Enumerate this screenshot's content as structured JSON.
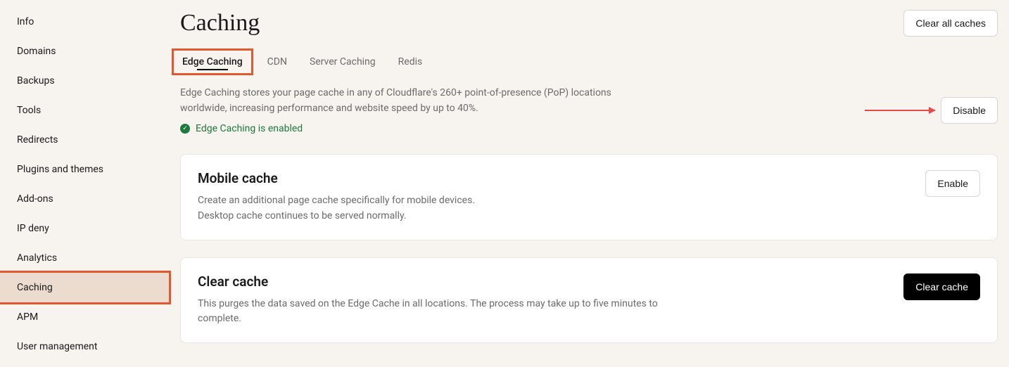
{
  "sidebar": {
    "items": [
      {
        "label": "Info"
      },
      {
        "label": "Domains"
      },
      {
        "label": "Backups"
      },
      {
        "label": "Tools"
      },
      {
        "label": "Redirects"
      },
      {
        "label": "Plugins and themes"
      },
      {
        "label": "Add-ons"
      },
      {
        "label": "IP deny"
      },
      {
        "label": "Analytics"
      },
      {
        "label": "Caching"
      },
      {
        "label": "APM"
      },
      {
        "label": "User management"
      }
    ],
    "active_index": 9
  },
  "header": {
    "title": "Caching",
    "clear_all_label": "Clear all caches"
  },
  "tabs": {
    "items": [
      {
        "label": "Edge Caching"
      },
      {
        "label": "CDN"
      },
      {
        "label": "Server Caching"
      },
      {
        "label": "Redis"
      }
    ],
    "active_index": 0
  },
  "edge": {
    "description": "Edge Caching stores your page cache in any of Cloudflare's 260+ point-of-presence (PoP) locations worldwide, increasing performance and website speed by up to 40%.",
    "status_text": "Edge Caching is enabled",
    "disable_label": "Disable"
  },
  "cards": {
    "mobile": {
      "title": "Mobile cache",
      "desc_line1": "Create an additional page cache specifically for mobile devices.",
      "desc_line2": "Desktop cache continues to be served normally.",
      "button_label": "Enable"
    },
    "clear": {
      "title": "Clear cache",
      "desc": "This purges the data saved on the Edge Cache in all locations. The process may take up to five minutes to complete.",
      "button_label": "Clear cache"
    }
  }
}
